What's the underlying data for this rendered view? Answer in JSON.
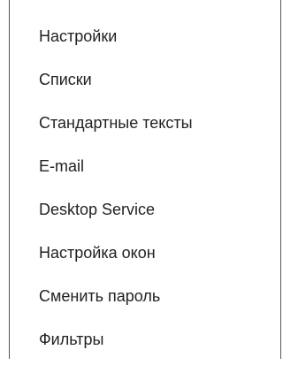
{
  "menu": {
    "items": [
      {
        "label": "Настройки"
      },
      {
        "label": "Списки"
      },
      {
        "label": "Стандартные тексты"
      },
      {
        "label": "E-mail"
      },
      {
        "label": "Desktop Service"
      },
      {
        "label": "Настройка окон"
      },
      {
        "label": "Сменить пароль"
      },
      {
        "label": "Фильтры"
      }
    ]
  }
}
